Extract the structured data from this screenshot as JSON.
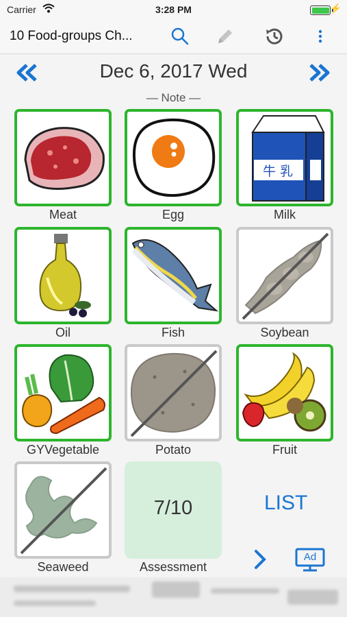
{
  "status": {
    "carrier": "Carrier",
    "time": "3:28 PM"
  },
  "toolbar": {
    "title": "10 Food-groups Ch..."
  },
  "date": {
    "text": "Dec 6, 2017 Wed"
  },
  "note": "— Note —",
  "foods": [
    {
      "label": "Meat",
      "checked": true
    },
    {
      "label": "Egg",
      "checked": true
    },
    {
      "label": "Milk",
      "checked": true
    },
    {
      "label": "Oil",
      "checked": true
    },
    {
      "label": "Fish",
      "checked": true
    },
    {
      "label": "Soybean",
      "checked": false
    },
    {
      "label": "GYVegetable",
      "checked": true
    },
    {
      "label": "Potato",
      "checked": false
    },
    {
      "label": "Fruit",
      "checked": true
    },
    {
      "label": "Seaweed",
      "checked": false
    }
  ],
  "milk_carton_text": "牛 乳",
  "assessment": {
    "score": "7/10",
    "label": "Assessment"
  },
  "list_link": "LIST",
  "ad_icon_label": "Ad",
  "colors": {
    "checked_border": "#2db52d",
    "unchecked_border": "#c9c9c9",
    "accent": "#1a75d2",
    "assessment_bg": "#d6efdd"
  }
}
